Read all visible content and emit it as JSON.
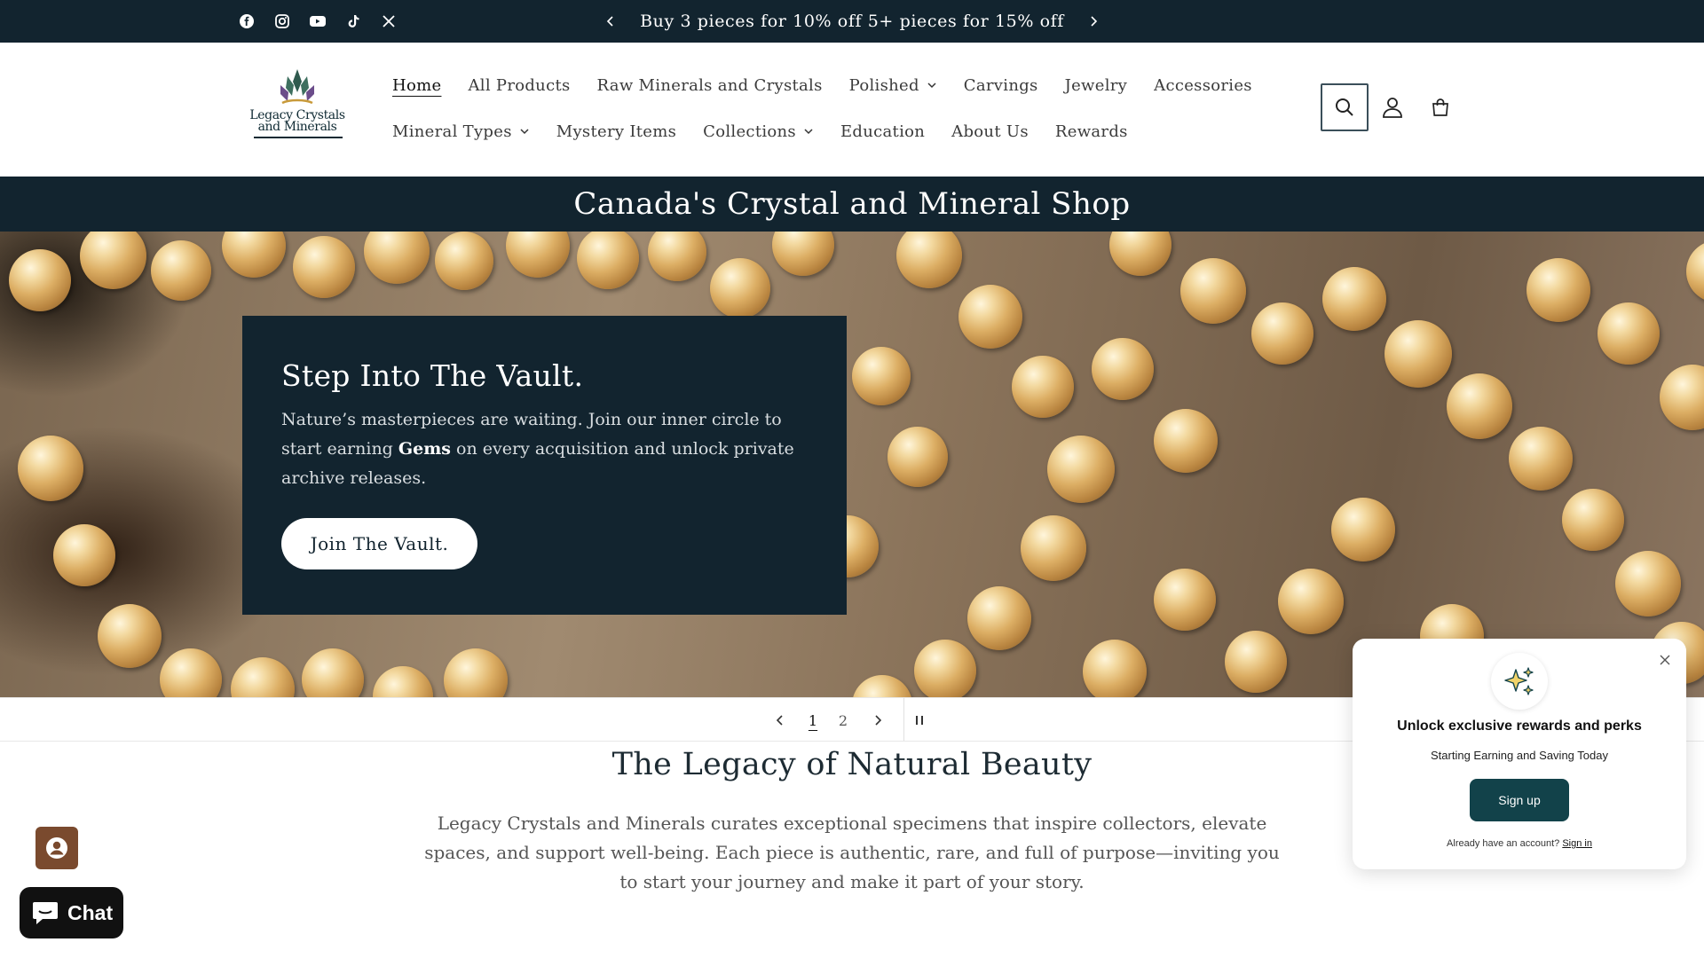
{
  "announcement": {
    "message": "Buy 3 pieces for 10% off 5+ pieces for 15% off",
    "social": [
      "facebook-icon",
      "instagram-icon",
      "youtube-icon",
      "tiktok-icon",
      "x-icon"
    ]
  },
  "logo": {
    "line1": "Legacy Crystals",
    "line2": "and Minerals"
  },
  "nav": {
    "row1": [
      {
        "label": "Home",
        "active": true,
        "dropdown": false
      },
      {
        "label": "All Products",
        "dropdown": false
      },
      {
        "label": "Raw Minerals and Crystals",
        "dropdown": false
      },
      {
        "label": "Polished",
        "dropdown": true
      },
      {
        "label": "Carvings",
        "dropdown": false
      },
      {
        "label": "Jewelry",
        "dropdown": false
      },
      {
        "label": "Accessories",
        "dropdown": false
      }
    ],
    "row2": [
      {
        "label": "Mineral Types",
        "dropdown": true
      },
      {
        "label": "Mystery Items",
        "dropdown": false
      },
      {
        "label": "Collections",
        "dropdown": true
      },
      {
        "label": "Education",
        "dropdown": false
      },
      {
        "label": "About Us",
        "dropdown": false
      },
      {
        "label": "Rewards",
        "dropdown": false
      }
    ]
  },
  "banner": {
    "text": "Canada's Crystal and Mineral Shop"
  },
  "hero": {
    "title": "Step Into The Vault.",
    "body_before": "Nature’s masterpieces are waiting. Join our inner circle to start earning ",
    "body_bold": "Gems",
    "body_after": " on every acquisition and unlock private archive releases.",
    "button": "Join The Vault."
  },
  "slider": {
    "slide1": "1",
    "slide2": "2",
    "current": 1
  },
  "legacy": {
    "title": "The Legacy of Natural Beauty",
    "text": "Legacy Crystals and Minerals curates exceptional specimens that inspire collectors, elevate spaces, and support well-being. Each piece is authentic, rare, and full of purpose—inviting you to start your journey and make it part of your story."
  },
  "chat": {
    "label": "Chat"
  },
  "rewards_popup": {
    "title": "Unlock exclusive rewards and perks",
    "subtitle": "Starting Earning and Saving Today",
    "button": "Sign up",
    "footer_text": "Already have an account?",
    "footer_link": "Sign in"
  },
  "colors": {
    "dark": "#12242f",
    "accent": "#12424a",
    "account_fab": "#7a4a2e"
  }
}
